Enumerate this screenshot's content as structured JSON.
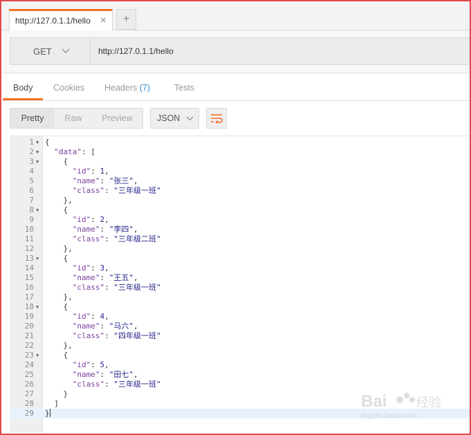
{
  "request_tab": {
    "label": "http://127.0.1.1/hello",
    "close_glyph": "×",
    "add_glyph": "+"
  },
  "request": {
    "method": "GET",
    "url": "http://127.0.1.1/hello"
  },
  "response_tabs": {
    "body": "Body",
    "cookies": "Cookies",
    "headers": "Headers",
    "headers_count": "(7)",
    "tests": "Tests",
    "active": "Body"
  },
  "view_modes": {
    "pretty": "Pretty",
    "raw": "Raw",
    "preview": "Preview",
    "active": "Pretty"
  },
  "format": {
    "selected": "JSON"
  },
  "colors": {
    "accent": "#f47023",
    "key": "#7a3e9d",
    "string": "#23238b",
    "count": "#2d8fcf"
  },
  "icons": [
    "close-icon",
    "plus-icon",
    "chevron-down-icon",
    "wrap-lines-icon",
    "fold-arrow-icon"
  ],
  "code_lines": [
    {
      "n": "1",
      "fold": true,
      "text": "{"
    },
    {
      "n": "2",
      "fold": true,
      "text": "  \"data\": ["
    },
    {
      "n": "3",
      "fold": true,
      "text": "    {"
    },
    {
      "n": "4",
      "fold": false,
      "text": "      \"id\": 1,"
    },
    {
      "n": "5",
      "fold": false,
      "text": "      \"name\": \"张三\","
    },
    {
      "n": "6",
      "fold": false,
      "text": "      \"class\": \"三年级一班\""
    },
    {
      "n": "7",
      "fold": false,
      "text": "    },"
    },
    {
      "n": "8",
      "fold": true,
      "text": "    {"
    },
    {
      "n": "9",
      "fold": false,
      "text": "      \"id\": 2,"
    },
    {
      "n": "10",
      "fold": false,
      "text": "      \"name\": \"李四\","
    },
    {
      "n": "11",
      "fold": false,
      "text": "      \"class\": \"三年级二班\""
    },
    {
      "n": "12",
      "fold": false,
      "text": "    },"
    },
    {
      "n": "13",
      "fold": true,
      "text": "    {"
    },
    {
      "n": "14",
      "fold": false,
      "text": "      \"id\": 3,"
    },
    {
      "n": "15",
      "fold": false,
      "text": "      \"name\": \"王五\","
    },
    {
      "n": "16",
      "fold": false,
      "text": "      \"class\": \"三年级一班\""
    },
    {
      "n": "17",
      "fold": false,
      "text": "    },"
    },
    {
      "n": "18",
      "fold": true,
      "text": "    {"
    },
    {
      "n": "19",
      "fold": false,
      "text": "      \"id\": 4,"
    },
    {
      "n": "20",
      "fold": false,
      "text": "      \"name\": \"马六\","
    },
    {
      "n": "21",
      "fold": false,
      "text": "      \"class\": \"四年级一班\""
    },
    {
      "n": "22",
      "fold": false,
      "text": "    },"
    },
    {
      "n": "23",
      "fold": true,
      "text": "    {"
    },
    {
      "n": "24",
      "fold": false,
      "text": "      \"id\": 5,"
    },
    {
      "n": "25",
      "fold": false,
      "text": "      \"name\": \"田七\","
    },
    {
      "n": "26",
      "fold": false,
      "text": "      \"class\": \"三年级一班\""
    },
    {
      "n": "27",
      "fold": false,
      "text": "    }"
    },
    {
      "n": "28",
      "fold": false,
      "text": "  ]"
    },
    {
      "n": "29",
      "fold": false,
      "text": "}",
      "current": true
    }
  ],
  "watermark": {
    "brand": "Baidu经验",
    "site": "jingyan.baidu.com"
  }
}
